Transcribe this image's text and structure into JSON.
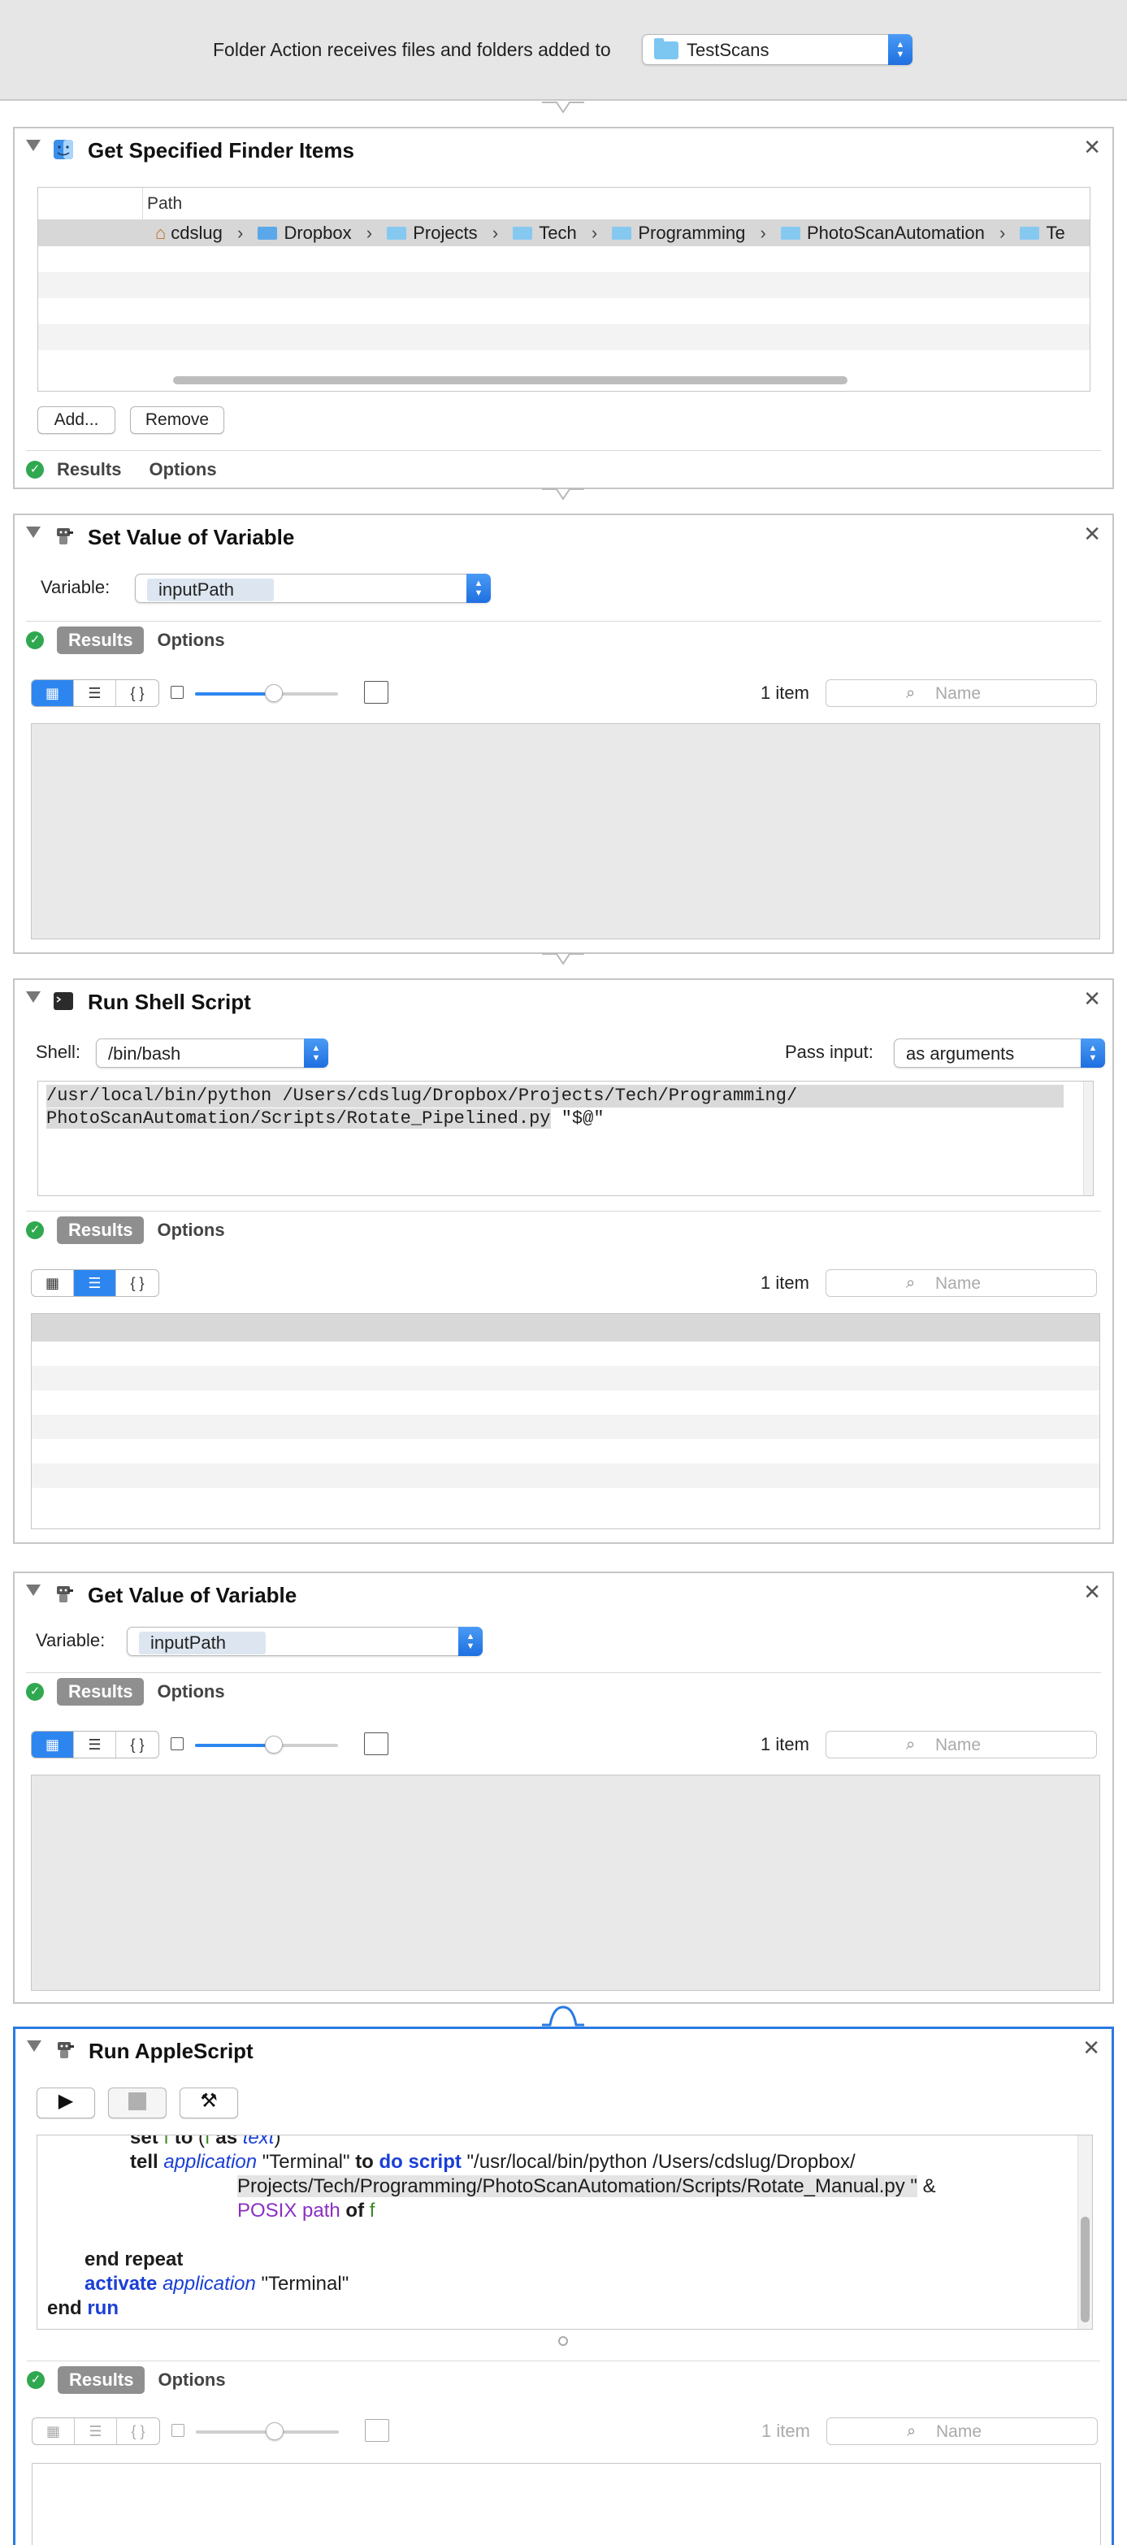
{
  "header": {
    "label": "Folder Action receives files and folders added to",
    "folder": "TestScans"
  },
  "actions": {
    "a1": {
      "title": "Get Specified Finder Items",
      "column_header": "Path",
      "path": [
        "cdslug",
        "Dropbox",
        "Projects",
        "Tech",
        "Programming",
        "PhotoScanAutomation",
        "Te"
      ],
      "add_label": "Add...",
      "remove_label": "Remove",
      "results_tab": "Results",
      "options_tab": "Options"
    },
    "a2": {
      "title": "Set Value of Variable",
      "variable_label": "Variable:",
      "variable_value": "inputPath",
      "results_tab": "Results",
      "options_tab": "Options",
      "item_count": "1 item",
      "search_placeholder": "Name",
      "slider_level": 0.55
    },
    "a3": {
      "title": "Run Shell Script",
      "shell_label": "Shell:",
      "shell_value": "/bin/bash",
      "pass_input_label": "Pass input:",
      "pass_input_value": "as arguments",
      "code_line1": "/usr/local/bin/python /Users/cdslug/Dropbox/Projects/Tech/Programming/",
      "code_line2": "PhotoScanAutomation/Scripts/Rotate_Pipelined.py",
      "code_line2_tail": " \"$@\"",
      "results_tab": "Results",
      "options_tab": "Options",
      "item_count": "1 item",
      "search_placeholder": "Name"
    },
    "a4": {
      "title": "Get Value of Variable",
      "variable_label": "Variable:",
      "variable_value": "inputPath",
      "results_tab": "Results",
      "options_tab": "Options",
      "item_count": "1 item",
      "search_placeholder": "Name",
      "slider_level": 0.55
    },
    "a5": {
      "title": "Run AppleScript",
      "results_tab": "Results",
      "options_tab": "Options",
      "item_count": "1 item",
      "search_placeholder": "Name",
      "slider_level": 0.55,
      "script": {
        "l1_kw1": "set",
        "l1_f1": "f",
        "l1_kw2": "to",
        "l1_open": "(",
        "l1_f2": "f",
        "l1_kw3": "as",
        "l1_cls": "text",
        "l1_close": ")",
        "l2_kw1": "tell",
        "l2_app": "application",
        "l2_str1": "\"Terminal\"",
        "l2_kw2": "to",
        "l2_kw3": "do script",
        "l2_str2": "\"/usr/local/bin/python /Users/cdslug/Dropbox/",
        "l3_str": "Projects/Tech/Programming/PhotoScanAutomation/Scripts/Rotate_Manual.py \"",
        "l3_amp": "&",
        "l4_prop": "POSIX path",
        "l4_kw": "of",
        "l4_var": "f",
        "l5": "end repeat",
        "l6_kw": "activate",
        "l6_app": "application",
        "l6_str": "\"Terminal\"",
        "l7_end": "end",
        "l7_run": "run"
      }
    }
  },
  "colors": {
    "accent": "#2d86f0",
    "selected_border": "#2a7ae2",
    "success": "#2fa84f",
    "keyword_blue": "#1a3fd6",
    "variable_green": "#3d8a25",
    "class_purple": "#8a2fc2"
  }
}
